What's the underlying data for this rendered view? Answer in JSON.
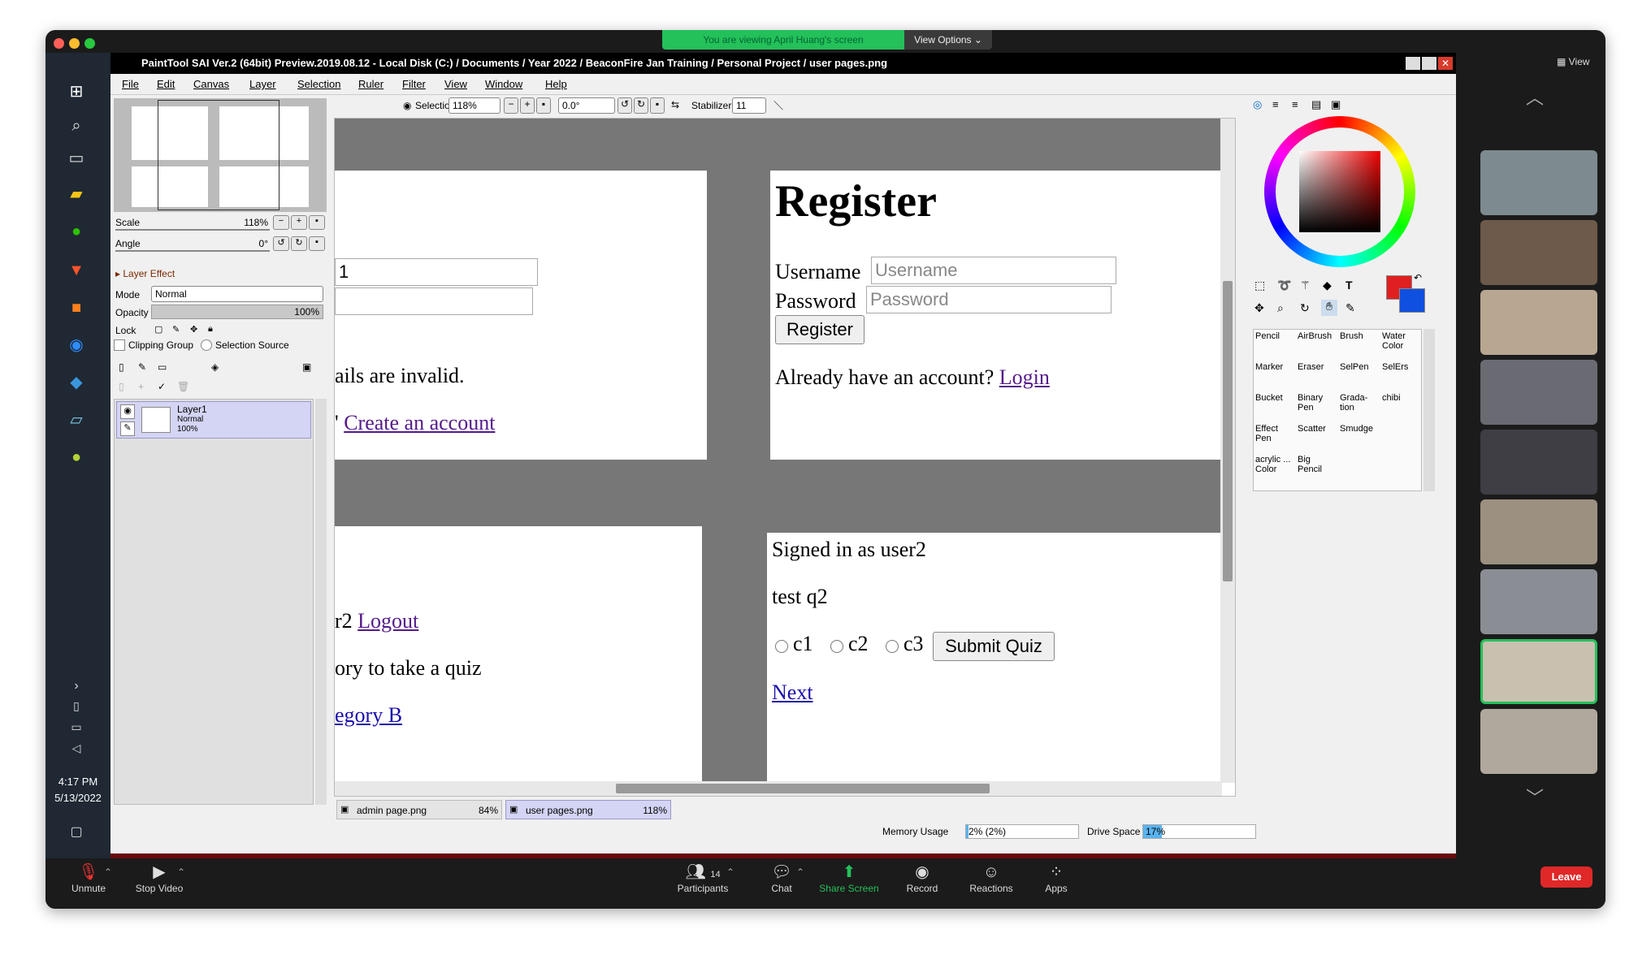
{
  "zoom": {
    "banner": "You are viewing April Huang's screen",
    "view_options": "View Options ⌄",
    "view_label": "View",
    "toolbar": {
      "unmute": "Unmute",
      "stop_video": "Stop Video",
      "participants": "Participants",
      "participants_count": "14",
      "chat": "Chat",
      "share_screen": "Share Screen",
      "record": "Record",
      "reactions": "Reactions",
      "apps": "Apps",
      "leave": "Leave"
    }
  },
  "windows": {
    "clock_time": "4:17 PM",
    "clock_date": "5/13/2022"
  },
  "sai": {
    "title": "PaintTool SAI Ver.2 (64bit) Preview.2019.08.12 - Local Disk (C:) / Documents / Year 2022 / BeaconFire Jan Training / Personal Project / user pages.png",
    "menu": [
      "File",
      "Edit",
      "Canvas",
      "Layer",
      "Selection",
      "Ruler",
      "Filter",
      "View",
      "Window",
      "Help"
    ],
    "toolbar": {
      "selection_label": "Selection",
      "zoom": "118%",
      "angle": "0.0°",
      "stabilizer_label": "Stabilizer",
      "stabilizer_value": "11"
    },
    "navigator": {
      "scale_label": "Scale",
      "scale_value": "118%",
      "angle_label": "Angle",
      "angle_value": "0°"
    },
    "layer_panel": {
      "layer_effect": "Layer Effect",
      "mode_label": "Mode",
      "mode_value": "Normal",
      "opacity_label": "Opacity",
      "opacity_value": "100%",
      "lock_label": "Lock",
      "clipping_group": "Clipping Group",
      "selection_source": "Selection Source",
      "layer_name": "Layer1",
      "layer_mode": "Normal",
      "layer_opacity": "100%"
    },
    "tools": [
      {
        "name": "Pencil"
      },
      {
        "name": "AirBrush"
      },
      {
        "name": "Brush"
      },
      {
        "name": "Water Color"
      },
      {
        "name": "Marker"
      },
      {
        "name": "Eraser"
      },
      {
        "name": "SelPen"
      },
      {
        "name": "SelErs"
      },
      {
        "name": "Bucket"
      },
      {
        "name": "Binary Pen"
      },
      {
        "name": "Grada-tion"
      },
      {
        "name": "chibi"
      },
      {
        "name": "Effect Pen"
      },
      {
        "name": "Scatter"
      },
      {
        "name": "Smudge"
      },
      {
        "name": ""
      },
      {
        "name": "acrylic ... Color"
      },
      {
        "name": "Big Pencil"
      },
      {
        "name": ""
      },
      {
        "name": ""
      }
    ],
    "tabs": [
      {
        "name": "admin page.png",
        "zoom": "84%"
      },
      {
        "name": "user pages.png",
        "zoom": "118%"
      }
    ],
    "status": {
      "memory_label": "Memory Usage",
      "memory_value": "2% (2%)",
      "memory_fraction": 0.02,
      "drive_label": "Drive Space",
      "drive_value": "17%",
      "drive_fraction": 0.17
    },
    "colors": {
      "primary": "#e02020",
      "secondary": "#1050e0"
    }
  },
  "canvas": {
    "login_page": {
      "username_partial": "1",
      "error_partial": "ails are invalid.",
      "create_prefix": "'",
      "create_link": "Create an account"
    },
    "register_page": {
      "title": "Register",
      "username_label": "Username",
      "username_placeholder": "Username",
      "password_label": "Password",
      "password_placeholder": "Password",
      "button": "Register",
      "already_text": "Already have an account?",
      "login_link": "Login"
    },
    "home_page": {
      "logout_prefix": "r2",
      "logout_link": "Logout",
      "category_text": "ory to take a quiz",
      "category_link": "egory B"
    },
    "quiz_page": {
      "signed_in": "Signed in as user2",
      "question": "test q2",
      "options": [
        "c1",
        "c2",
        "c3"
      ],
      "submit": "Submit Quiz",
      "next_link": "Next"
    }
  }
}
